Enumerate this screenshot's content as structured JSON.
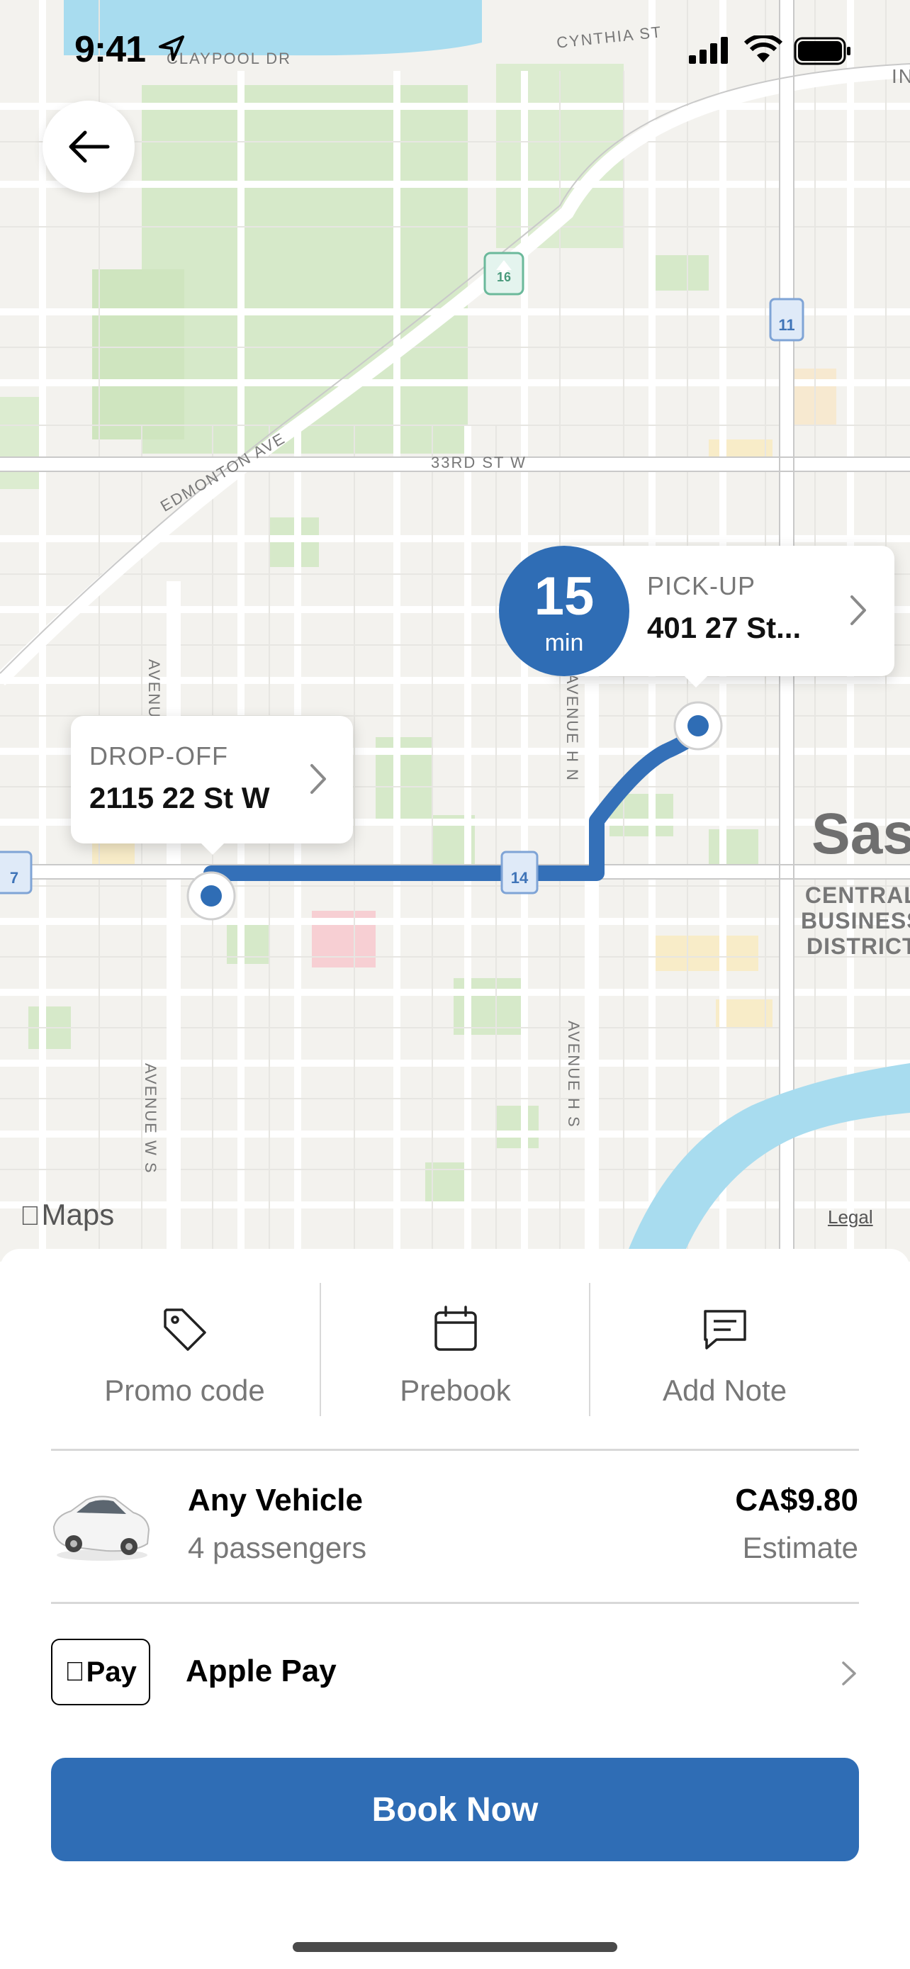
{
  "status_bar": {
    "time": "9:41"
  },
  "map": {
    "streets": {
      "claypool": "CLAYPOOL DR",
      "cynthia": "CYNTHIA ST",
      "thirty_third": "33RD ST W",
      "edmonton": "EDMONTON AVE",
      "avenue_w_s": "AVENUE W S",
      "avenue_h_s": "AVENUE H S",
      "avenue_top_left": "AVENUE",
      "avenue_top_right": "AVENUE H N",
      "in_edge": "IN"
    },
    "highway_shields": [
      "16",
      "11",
      "14",
      "7"
    ],
    "district_big": "Sas",
    "district_small": "CENTRAL\nBUSINESS\nDISTRICT",
    "maps_brand": "Maps",
    "legal": "Legal",
    "eta": {
      "number": "15",
      "unit": "min"
    },
    "pickup": {
      "label": "PICK-UP",
      "address": "401 27 St..."
    },
    "dropoff": {
      "label": "DROP-OFF",
      "address": "2115 22 St W"
    }
  },
  "actions": [
    {
      "label": "Promo code",
      "icon": "tag-icon"
    },
    {
      "label": "Prebook",
      "icon": "calendar-icon"
    },
    {
      "label": "Add Note",
      "icon": "message-icon"
    }
  ],
  "vehicle": {
    "name": "Any Vehicle",
    "passengers": "4 passengers",
    "price": "CA$9.80",
    "price_note": "Estimate"
  },
  "payment": {
    "badge": "Pay",
    "method": "Apple Pay"
  },
  "book_button": "Book Now",
  "colors": {
    "accent": "#2f6db5",
    "route": "#3470b8",
    "map_bg": "#f3f2ee",
    "park": "#d6e9c9",
    "water": "#a8dcef"
  }
}
